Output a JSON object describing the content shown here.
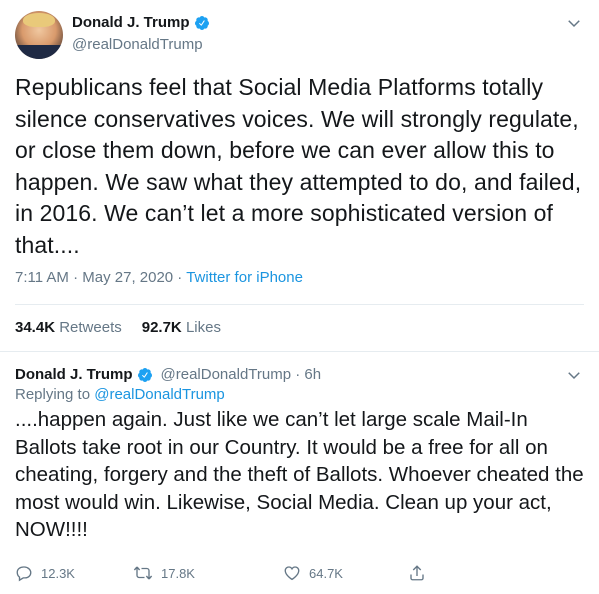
{
  "main_tweet": {
    "display_name": "Donald J. Trump",
    "handle": "@realDonaldTrump",
    "text": "Republicans feel that Social Media Platforms totally silence conservatives voices. We will strongly regulate, or close them down, before we can ever allow this to happen. We saw what they attempted to do, and failed, in 2016. We can’t let a more sophisticated version of that....",
    "timestamp": "7:11 AM · May 27, 2020 · ",
    "source": "Twitter for iPhone",
    "retweets_count": "34.4K",
    "retweets_label": "Retweets",
    "likes_count": "92.7K",
    "likes_label": "Likes"
  },
  "reply_tweet": {
    "display_name": "Donald J. Trump",
    "handle_time": "@realDonaldTrump · 6h",
    "replying_to_label": "Replying to ",
    "replying_to_mention": "@realDonaldTrump",
    "text": "....happen again. Just like we can’t let large scale Mail-In Ballots take root in our Country. It would be a free for all on cheating, forgery and the theft of Ballots. Whoever cheated the most would win. Likewise, Social Media. Clean up your act, NOW!!!!",
    "reply_count": "12.3K",
    "retweet_count": "17.8K",
    "like_count": "64.7K"
  },
  "icons": {
    "verified": "verified-badge-icon",
    "chevron": "chevron-down-icon",
    "reply": "reply-icon",
    "retweet": "retweet-icon",
    "like": "heart-icon",
    "share": "share-icon"
  },
  "colors": {
    "accent": "#1b95e0",
    "verified": "#1da1f2",
    "secondary_text": "#657786",
    "primary_text": "#14171a",
    "border": "#e6ecf0"
  }
}
